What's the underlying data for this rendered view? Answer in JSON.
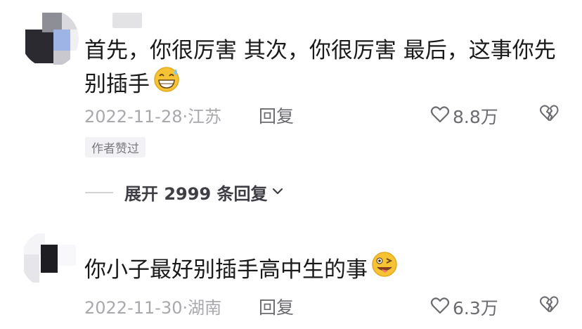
{
  "comments": [
    {
      "text_lines": [
        "首先，你很厉害 其次，你很厉害 最后，这事你先",
        "别插手"
      ],
      "emoji": "sweat-grin-emoji",
      "date_location": "2022-11-28·江苏",
      "reply_label": "回复",
      "like_count": "8.8万",
      "author_badge": "作者赞过",
      "expand_label": "展开 2999 条回复"
    },
    {
      "text_lines": [
        "你小子最好别插手高中生的事"
      ],
      "emoji": "wink-tongue-emoji",
      "date_location": "2022-11-30·湖南",
      "reply_label": "回复",
      "like_count": "6.3万"
    }
  ],
  "icons": {
    "like": "heart-outline-icon",
    "dislike": "broken-heart-icon",
    "expand": "chevron-down-icon"
  },
  "colors": {
    "text": "#1a1a1a",
    "meta": "#a8a8ad",
    "action": "#6b6b70",
    "emoji_yellow": "#f6c335"
  }
}
